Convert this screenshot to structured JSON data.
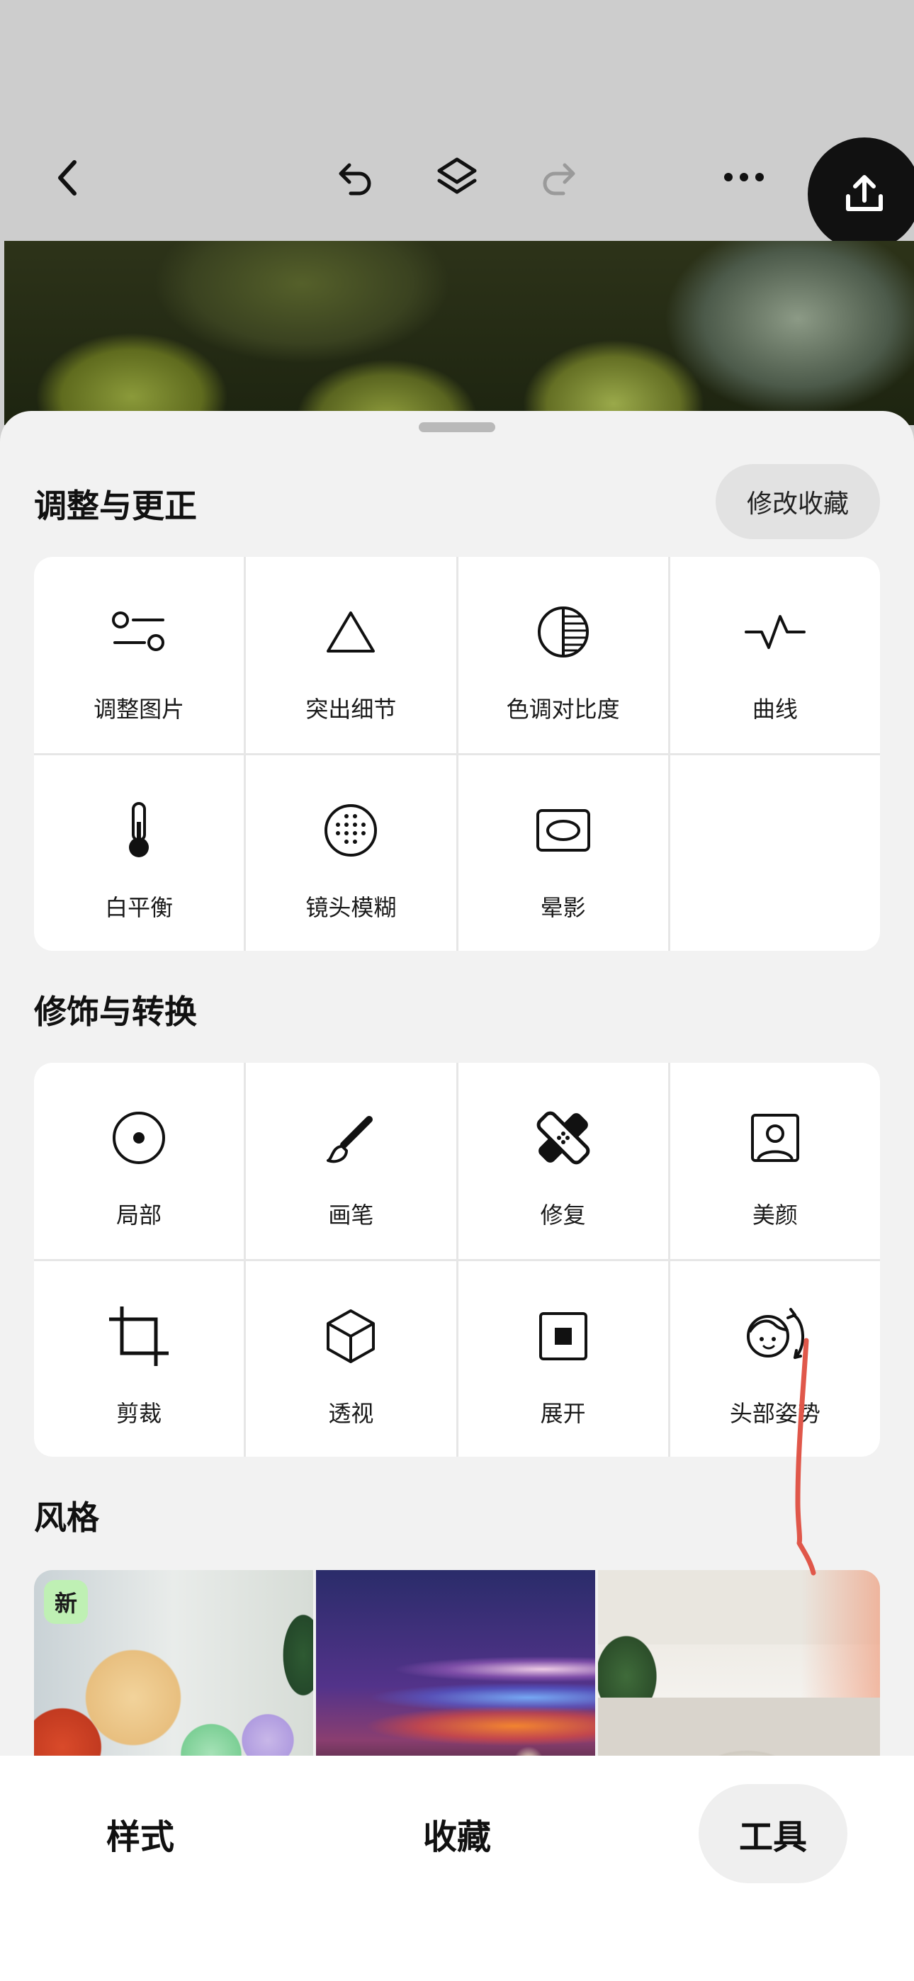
{
  "toolbar": {
    "back_icon": "chevron-left-icon",
    "undo_icon": "undo-icon",
    "layers_icon": "layers-icon",
    "redo_icon": "redo-icon",
    "more_icon": "more-horizontal-icon",
    "export_icon": "upload-icon"
  },
  "sections": {
    "adjust": {
      "title": "调整与更正",
      "favorites_button": "修改收藏",
      "tools": [
        {
          "label": "调整图片",
          "icon": "sliders-icon"
        },
        {
          "label": "突出细节",
          "icon": "triangle-icon"
        },
        {
          "label": "色调对比度",
          "icon": "half-circle-icon"
        },
        {
          "label": "曲线",
          "icon": "curve-icon"
        },
        {
          "label": "白平衡",
          "icon": "thermometer-icon"
        },
        {
          "label": "镜头模糊",
          "icon": "dotted-circle-icon"
        },
        {
          "label": "晕影",
          "icon": "vignette-icon"
        }
      ]
    },
    "retouch": {
      "title": "修饰与转换",
      "tools": [
        {
          "label": "局部",
          "icon": "target-icon"
        },
        {
          "label": "画笔",
          "icon": "brush-icon"
        },
        {
          "label": "修复",
          "icon": "bandage-icon"
        },
        {
          "label": "美颜",
          "icon": "portrait-icon"
        },
        {
          "label": "剪裁",
          "icon": "crop-icon"
        },
        {
          "label": "透视",
          "icon": "cube-icon"
        },
        {
          "label": "展开",
          "icon": "expand-icon"
        },
        {
          "label": "头部姿势",
          "icon": "head-pose-icon"
        }
      ]
    },
    "styles": {
      "title": "风格",
      "new_badge": "新"
    }
  },
  "bottom_nav": {
    "items": [
      {
        "label": "样式"
      },
      {
        "label": "收藏"
      },
      {
        "label": "工具"
      }
    ],
    "active": "工具"
  },
  "colors": {
    "accent_annotation": "#e0574a",
    "new_badge": "#bff0b4"
  }
}
